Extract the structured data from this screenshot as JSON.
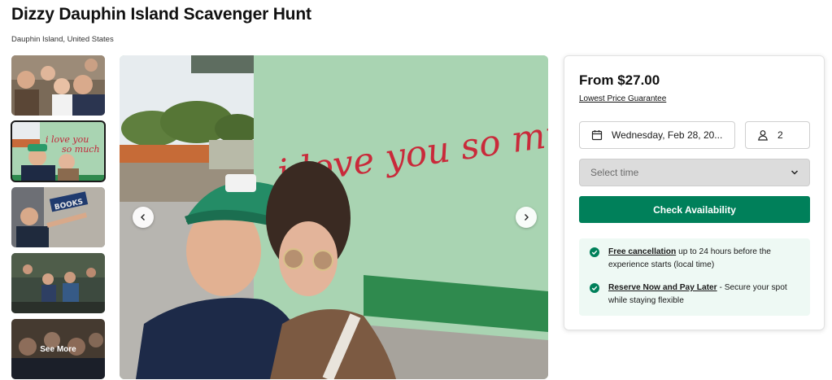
{
  "page": {
    "title": "Dizzy Dauphin Island Scavenger Hunt",
    "location": "Dauphin Island, United States"
  },
  "gallery": {
    "see_more_label": "See More",
    "main_photo_wall_text": "i love you so much",
    "thumbnails": [
      {
        "name": "group-photo"
      },
      {
        "name": "love-wall-photo"
      },
      {
        "name": "books-sign-photo"
      },
      {
        "name": "crowd-photo"
      },
      {
        "name": "group-photo-2"
      }
    ]
  },
  "booking": {
    "price_label": "From $27.00",
    "guarantee_label": "Lowest Price Guarantee",
    "date_value": "Wednesday, Feb 28, 20...",
    "guests_value": "2",
    "time_placeholder": "Select time",
    "check_button_label": "Check Availability",
    "perks": [
      {
        "title": "Free cancellation",
        "text": " up to 24 hours before the experience starts (local time)"
      },
      {
        "title": "Reserve Now and Pay Later",
        "text": " - Secure your spot while staying flexible"
      }
    ]
  },
  "colors": {
    "accent": "#00805a",
    "perk_bg": "#eef9f4",
    "wall": "#a9d4b2"
  },
  "icons": [
    "calendar-icon",
    "person-icon",
    "chevron-down-icon",
    "chevron-left-icon",
    "chevron-right-icon",
    "check-circle-icon"
  ]
}
